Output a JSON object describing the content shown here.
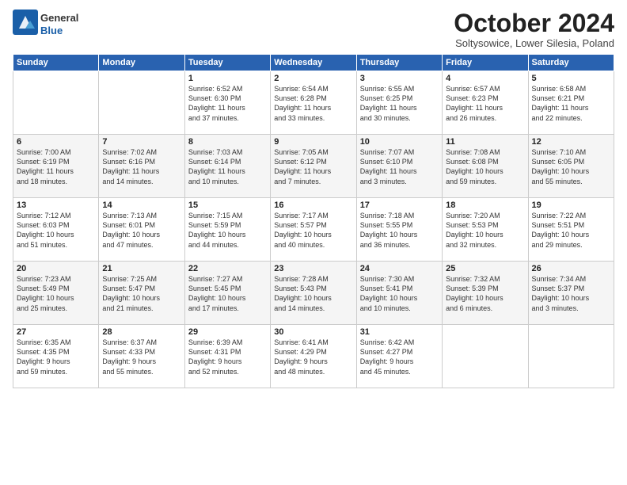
{
  "logo": {
    "general": "General",
    "blue": "Blue"
  },
  "header": {
    "month": "October 2024",
    "location": "Soltysowice, Lower Silesia, Poland"
  },
  "days_of_week": [
    "Sunday",
    "Monday",
    "Tuesday",
    "Wednesday",
    "Thursday",
    "Friday",
    "Saturday"
  ],
  "weeks": [
    {
      "row": 1,
      "days": [
        {
          "num": "",
          "detail": ""
        },
        {
          "num": "",
          "detail": ""
        },
        {
          "num": "1",
          "detail": "Sunrise: 6:52 AM\nSunset: 6:30 PM\nDaylight: 11 hours\nand 37 minutes."
        },
        {
          "num": "2",
          "detail": "Sunrise: 6:54 AM\nSunset: 6:28 PM\nDaylight: 11 hours\nand 33 minutes."
        },
        {
          "num": "3",
          "detail": "Sunrise: 6:55 AM\nSunset: 6:25 PM\nDaylight: 11 hours\nand 30 minutes."
        },
        {
          "num": "4",
          "detail": "Sunrise: 6:57 AM\nSunset: 6:23 PM\nDaylight: 11 hours\nand 26 minutes."
        },
        {
          "num": "5",
          "detail": "Sunrise: 6:58 AM\nSunset: 6:21 PM\nDaylight: 11 hours\nand 22 minutes."
        }
      ]
    },
    {
      "row": 2,
      "days": [
        {
          "num": "6",
          "detail": "Sunrise: 7:00 AM\nSunset: 6:19 PM\nDaylight: 11 hours\nand 18 minutes."
        },
        {
          "num": "7",
          "detail": "Sunrise: 7:02 AM\nSunset: 6:16 PM\nDaylight: 11 hours\nand 14 minutes."
        },
        {
          "num": "8",
          "detail": "Sunrise: 7:03 AM\nSunset: 6:14 PM\nDaylight: 11 hours\nand 10 minutes."
        },
        {
          "num": "9",
          "detail": "Sunrise: 7:05 AM\nSunset: 6:12 PM\nDaylight: 11 hours\nand 7 minutes."
        },
        {
          "num": "10",
          "detail": "Sunrise: 7:07 AM\nSunset: 6:10 PM\nDaylight: 11 hours\nand 3 minutes."
        },
        {
          "num": "11",
          "detail": "Sunrise: 7:08 AM\nSunset: 6:08 PM\nDaylight: 10 hours\nand 59 minutes."
        },
        {
          "num": "12",
          "detail": "Sunrise: 7:10 AM\nSunset: 6:05 PM\nDaylight: 10 hours\nand 55 minutes."
        }
      ]
    },
    {
      "row": 3,
      "days": [
        {
          "num": "13",
          "detail": "Sunrise: 7:12 AM\nSunset: 6:03 PM\nDaylight: 10 hours\nand 51 minutes."
        },
        {
          "num": "14",
          "detail": "Sunrise: 7:13 AM\nSunset: 6:01 PM\nDaylight: 10 hours\nand 47 minutes."
        },
        {
          "num": "15",
          "detail": "Sunrise: 7:15 AM\nSunset: 5:59 PM\nDaylight: 10 hours\nand 44 minutes."
        },
        {
          "num": "16",
          "detail": "Sunrise: 7:17 AM\nSunset: 5:57 PM\nDaylight: 10 hours\nand 40 minutes."
        },
        {
          "num": "17",
          "detail": "Sunrise: 7:18 AM\nSunset: 5:55 PM\nDaylight: 10 hours\nand 36 minutes."
        },
        {
          "num": "18",
          "detail": "Sunrise: 7:20 AM\nSunset: 5:53 PM\nDaylight: 10 hours\nand 32 minutes."
        },
        {
          "num": "19",
          "detail": "Sunrise: 7:22 AM\nSunset: 5:51 PM\nDaylight: 10 hours\nand 29 minutes."
        }
      ]
    },
    {
      "row": 4,
      "days": [
        {
          "num": "20",
          "detail": "Sunrise: 7:23 AM\nSunset: 5:49 PM\nDaylight: 10 hours\nand 25 minutes."
        },
        {
          "num": "21",
          "detail": "Sunrise: 7:25 AM\nSunset: 5:47 PM\nDaylight: 10 hours\nand 21 minutes."
        },
        {
          "num": "22",
          "detail": "Sunrise: 7:27 AM\nSunset: 5:45 PM\nDaylight: 10 hours\nand 17 minutes."
        },
        {
          "num": "23",
          "detail": "Sunrise: 7:28 AM\nSunset: 5:43 PM\nDaylight: 10 hours\nand 14 minutes."
        },
        {
          "num": "24",
          "detail": "Sunrise: 7:30 AM\nSunset: 5:41 PM\nDaylight: 10 hours\nand 10 minutes."
        },
        {
          "num": "25",
          "detail": "Sunrise: 7:32 AM\nSunset: 5:39 PM\nDaylight: 10 hours\nand 6 minutes."
        },
        {
          "num": "26",
          "detail": "Sunrise: 7:34 AM\nSunset: 5:37 PM\nDaylight: 10 hours\nand 3 minutes."
        }
      ]
    },
    {
      "row": 5,
      "days": [
        {
          "num": "27",
          "detail": "Sunrise: 6:35 AM\nSunset: 4:35 PM\nDaylight: 9 hours\nand 59 minutes."
        },
        {
          "num": "28",
          "detail": "Sunrise: 6:37 AM\nSunset: 4:33 PM\nDaylight: 9 hours\nand 55 minutes."
        },
        {
          "num": "29",
          "detail": "Sunrise: 6:39 AM\nSunset: 4:31 PM\nDaylight: 9 hours\nand 52 minutes."
        },
        {
          "num": "30",
          "detail": "Sunrise: 6:41 AM\nSunset: 4:29 PM\nDaylight: 9 hours\nand 48 minutes."
        },
        {
          "num": "31",
          "detail": "Sunrise: 6:42 AM\nSunset: 4:27 PM\nDaylight: 9 hours\nand 45 minutes."
        },
        {
          "num": "",
          "detail": ""
        },
        {
          "num": "",
          "detail": ""
        }
      ]
    }
  ]
}
